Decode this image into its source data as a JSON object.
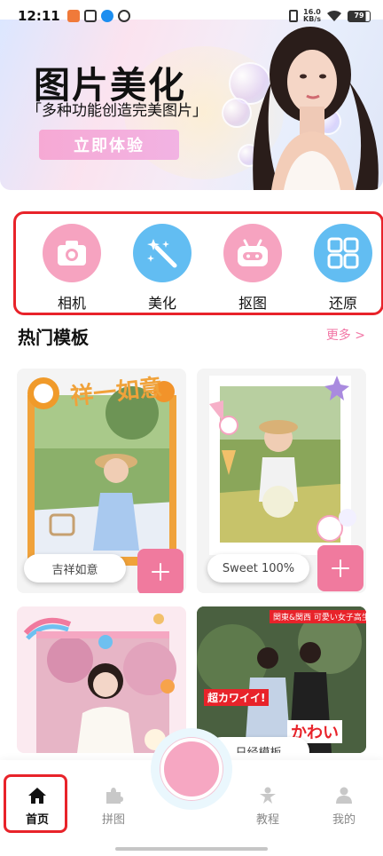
{
  "status_bar": {
    "time": "12:11",
    "net_speed_top": "16.0",
    "net_speed_bottom": "KB/s",
    "battery": "79"
  },
  "banner": {
    "title": "图片美化",
    "subtitle": "「多种功能创造完美图片」",
    "cta_label": "立即体验"
  },
  "tools": [
    {
      "label": "相机",
      "icon": "camera-icon",
      "color": "#f6a3c0"
    },
    {
      "label": "美化",
      "icon": "magic-wand-icon",
      "color": "#62bdf2"
    },
    {
      "label": "抠图",
      "icon": "robot-icon",
      "color": "#f6a3c0"
    },
    {
      "label": "还原",
      "icon": "grid-icon",
      "color": "#62bdf2"
    }
  ],
  "section": {
    "title": "热门模板",
    "more_label": "更多 >"
  },
  "templates": [
    {
      "label": "吉祥如意",
      "frame_text": "祥一如意"
    },
    {
      "label": "Sweet 100%"
    },
    {
      "label": ""
    },
    {
      "label": "日经模板",
      "overlay_texts": [
        "関東&関西 可愛い女子高生",
        "超カワイイ!",
        "かわい"
      ]
    }
  ],
  "bottom_nav": [
    {
      "label": "首页",
      "icon": "home-icon",
      "active": true
    },
    {
      "label": "拼图",
      "icon": "puzzle-icon",
      "active": false
    },
    {
      "label": "教程",
      "icon": "tutorial-person-icon",
      "active": false
    },
    {
      "label": "我的",
      "icon": "profile-icon",
      "active": false
    }
  ],
  "colors": {
    "accent_pink": "#f07a9e",
    "accent_blue": "#62bdf2",
    "highlight_red": "#e8232a"
  }
}
